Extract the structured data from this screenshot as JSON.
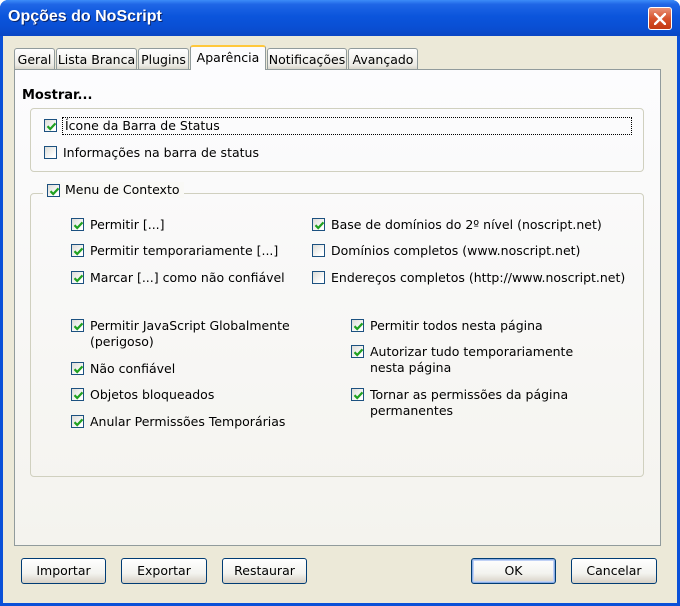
{
  "window": {
    "title": "Opções do NoScript"
  },
  "tabs": [
    {
      "label": "Geral"
    },
    {
      "label": "Lista Branca"
    },
    {
      "label": "Plugins"
    },
    {
      "label": "Aparência",
      "active": true
    },
    {
      "label": "Notificações"
    },
    {
      "label": "Avançado"
    }
  ],
  "mostrar": {
    "title": "Mostrar...",
    "items": [
      {
        "label": "Ícone da Barra de Status",
        "checked": true
      },
      {
        "label": "Informações na barra de status",
        "checked": false
      }
    ]
  },
  "context_menu": {
    "label": "Menu de Contexto",
    "checked": true,
    "left_items": [
      {
        "label": "Permitir [...]",
        "checked": true
      },
      {
        "label": "Permitir temporariamente [...]",
        "checked": true
      },
      {
        "label": "Marcar [...] como não confiável",
        "checked": true
      }
    ],
    "right_items": [
      {
        "label": "Base de domínios do 2º nível (noscript.net)",
        "checked": true
      },
      {
        "label": "Domínios completos (www.noscript.net)",
        "checked": false
      },
      {
        "label": "Endereços completos (http://www.noscript.net)",
        "checked": false
      }
    ],
    "lower_left_items": [
      {
        "label": "Permitir JavaScript Globalmente (perigoso)",
        "checked": true
      },
      {
        "label": "Não confiável",
        "checked": true
      },
      {
        "label": "Objetos bloqueados",
        "checked": true
      },
      {
        "label": "Anular Permissões Temporárias",
        "checked": true
      }
    ],
    "lower_right_items": [
      {
        "label": "Permitir todos nesta página",
        "checked": true
      },
      {
        "label": "Autorizar tudo temporariamente nesta página",
        "checked": true
      },
      {
        "label": "Tornar as permissões da página permanentes",
        "checked": true
      }
    ]
  },
  "buttons": {
    "import": "Importar",
    "export": "Exportar",
    "reset": "Restaurar",
    "ok": "OK",
    "cancel": "Cancelar"
  },
  "icons": {
    "checkmark": "check-icon",
    "close": "close-icon"
  },
  "colors": {
    "titlebar": "#0a50d8",
    "close_button": "#d7532d",
    "face": "#ece9d8",
    "check": "#21a121",
    "active_tab_accent": "#ffc83c"
  }
}
